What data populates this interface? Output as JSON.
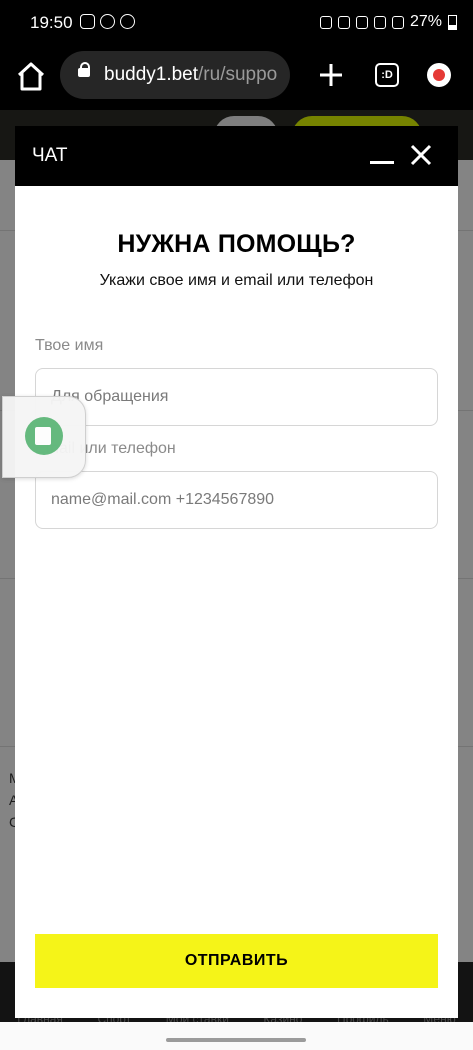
{
  "status_bar": {
    "time": "19:50",
    "battery": "27%"
  },
  "browser": {
    "url_domain": "buddy1.bet",
    "url_path": "/ru/suppo",
    "tabs_label": ":D"
  },
  "site": {
    "footer_lines": [
      "M",
      "A",
      "C"
    ],
    "nav_labels": [
      "Главная",
      "Спорт",
      "Мои ставки",
      "Казино",
      "Профиль",
      "Меню"
    ]
  },
  "chat": {
    "title": "ЧАТ",
    "heading": "НУЖНА ПОМОЩЬ?",
    "subheading": "Укажи свое имя и email или телефон",
    "name_label": "Твое имя",
    "name_placeholder": "Для обращения",
    "contact_label": "Email или телефон",
    "contact_placeholder": "name@mail.com +1234567890",
    "submit_label": "ОТПРАВИТЬ"
  }
}
